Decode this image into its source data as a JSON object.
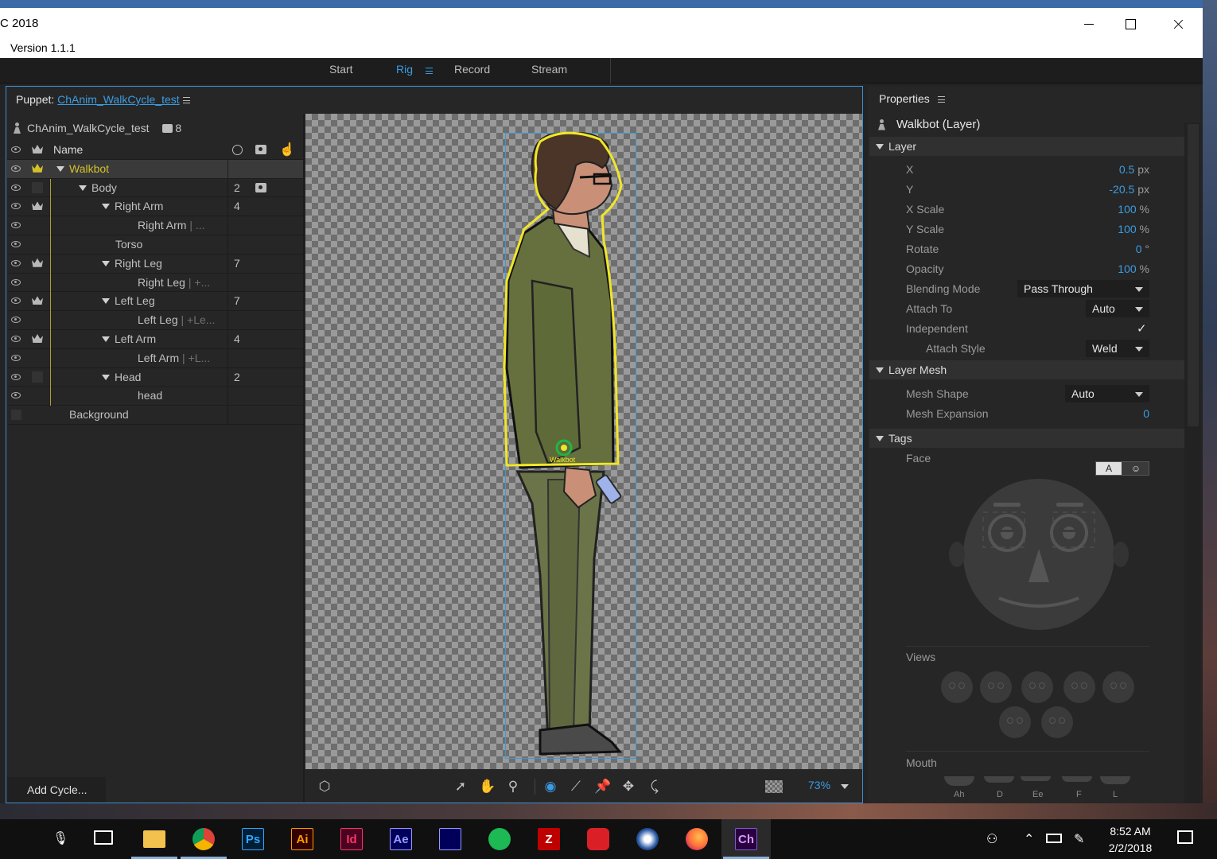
{
  "window": {
    "title": "C 2018",
    "version_label": "Version 1.1.1"
  },
  "modes": [
    {
      "label": "Start",
      "active": false
    },
    {
      "label": "Rig",
      "active": true
    },
    {
      "label": "Record",
      "active": false
    },
    {
      "label": "Stream",
      "active": false
    }
  ],
  "puppet_panel": {
    "prefix": "Puppet:",
    "puppet_link": "ChAnim_WalkCycle_test",
    "puppet_name": "ChAnim_WalkCycle_test",
    "puppet_count": "8",
    "name_header": "Name",
    "add_cycle_label": "Add Cycle...",
    "layers": [
      {
        "label": "Walkbot",
        "count": "",
        "suffix": ""
      },
      {
        "label": "Body",
        "count": "2",
        "suffix": ""
      },
      {
        "label": "Right Arm",
        "count": "4",
        "suffix": ""
      },
      {
        "label": "Right Arm",
        "count": "",
        "suffix": "| ..."
      },
      {
        "label": "Torso",
        "count": "",
        "suffix": ""
      },
      {
        "label": "Right Leg",
        "count": "7",
        "suffix": ""
      },
      {
        "label": "Right Leg",
        "count": "",
        "suffix": "| +..."
      },
      {
        "label": "Left Leg",
        "count": "7",
        "suffix": ""
      },
      {
        "label": "Left Leg",
        "count": "",
        "suffix": "| +Le..."
      },
      {
        "label": "Left Arm",
        "count": "4",
        "suffix": ""
      },
      {
        "label": "Left Arm",
        "count": "",
        "suffix": "| +L..."
      },
      {
        "label": "Head",
        "count": "2",
        "suffix": ""
      },
      {
        "label": "head",
        "count": "",
        "suffix": ""
      },
      {
        "label": "Background",
        "count": "",
        "suffix": ""
      }
    ]
  },
  "canvas": {
    "origin_label": "Walkbot",
    "zoom": "73%"
  },
  "properties": {
    "title": "Properties",
    "layer_name": "Walkbot (Layer)",
    "layer_section": "Layer",
    "x_label": "X",
    "x_value": "0.5",
    "x_unit": "px",
    "y_label": "Y",
    "y_value": "-20.5",
    "y_unit": "px",
    "xscale_label": "X Scale",
    "xscale_value": "100",
    "xscale_unit": "%",
    "yscale_label": "Y Scale",
    "yscale_value": "100",
    "yscale_unit": "%",
    "rotate_label": "Rotate",
    "rotate_value": "0",
    "rotate_unit": "°",
    "opacity_label": "Opacity",
    "opacity_value": "100",
    "opacity_unit": "%",
    "blending_label": "Blending Mode",
    "blending_value": "Pass Through",
    "attach_to_label": "Attach To",
    "attach_to_value": "Auto",
    "independent_label": "Independent",
    "independent_checked": true,
    "attach_style_label": "Attach Style",
    "attach_style_value": "Weld",
    "mesh_section": "Layer Mesh",
    "mesh_shape_label": "Mesh Shape",
    "mesh_shape_value": "Auto",
    "mesh_expansion_label": "Mesh Expansion",
    "mesh_expansion_value": "0",
    "tags_section": "Tags",
    "face_label": "Face",
    "face_toggle_a": "A",
    "face_toggle_b": "☺",
    "views_label": "Views",
    "mouth_label": "Mouth",
    "mouth_shapes": [
      "Ah",
      "D",
      "Ee",
      "F",
      "L"
    ]
  },
  "taskbar": {
    "time": "8:52 AM",
    "date": "2/2/2018",
    "apps": [
      {
        "name": "file-explorer",
        "label": "",
        "color": "#f2c14e"
      },
      {
        "name": "chrome",
        "label": "",
        "color": "#4caf50"
      },
      {
        "name": "photoshop",
        "label": "Ps",
        "color": "#31a8ff"
      },
      {
        "name": "illustrator",
        "label": "Ai",
        "color": "#ff9a00"
      },
      {
        "name": "indesign",
        "label": "Id",
        "color": "#ff3366"
      },
      {
        "name": "after-effects",
        "label": "Ae",
        "color": "#9999ff"
      },
      {
        "name": "premiere",
        "label": "",
        "color": "#9999ff"
      },
      {
        "name": "spotify",
        "label": "",
        "color": "#1db954"
      },
      {
        "name": "filezilla",
        "label": "Z",
        "color": "#bf0000"
      },
      {
        "name": "creative-cloud",
        "label": "",
        "color": "#da1f26"
      },
      {
        "name": "cinema4d",
        "label": "",
        "color": "#2a5aa8"
      },
      {
        "name": "firefox",
        "label": "",
        "color": "#ff7139"
      },
      {
        "name": "character-animator",
        "label": "Ch",
        "color": "#7c5cd6"
      }
    ]
  }
}
